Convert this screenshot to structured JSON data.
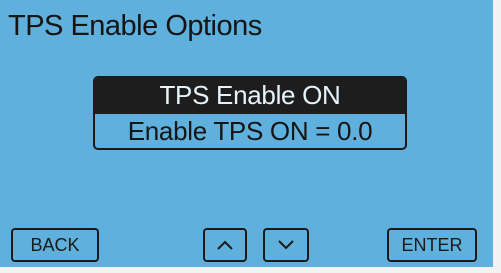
{
  "screen": {
    "title": "TPS Enable Options"
  },
  "options": {
    "selected": "TPS Enable ON",
    "items": [
      "Enable TPS ON = 0.0"
    ]
  },
  "buttons": {
    "back": "BACK",
    "up_icon": "chevron-up-icon",
    "down_icon": "chevron-down-icon",
    "enter": "ENTER"
  },
  "colors": {
    "background": "#5fb0dc",
    "selection": "#1d1d1d",
    "text": "#1a1a1a"
  }
}
